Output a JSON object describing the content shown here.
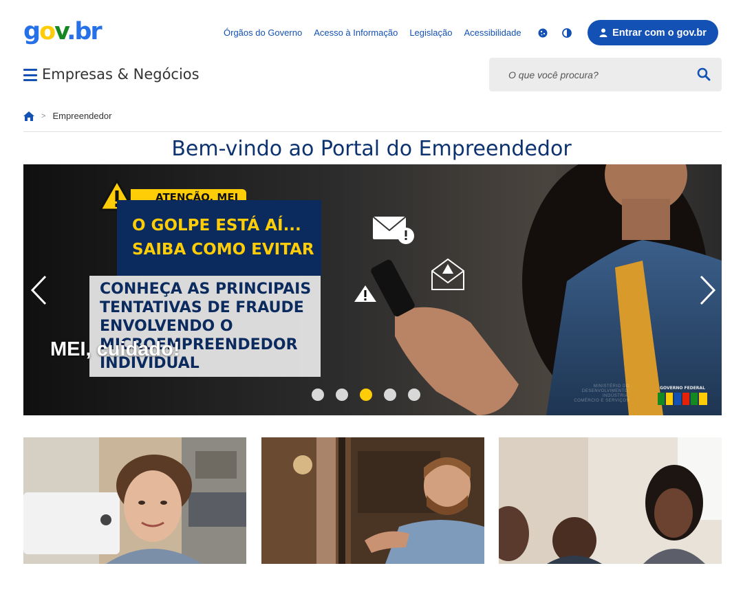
{
  "header": {
    "logo": {
      "g": "g",
      "o": "o",
      "v": "v",
      "dot": ".",
      "br": "br"
    },
    "nav_links": [
      "Órgãos do Governo",
      "Acesso à Informação",
      "Legislação",
      "Acessibilidade"
    ],
    "login_label": "Entrar com o gov.br",
    "site_title": "Empresas & Negócios",
    "search_placeholder": "O que você procura?"
  },
  "breadcrumb": {
    "current": "Empreendedor",
    "separator": ">"
  },
  "page_title": "Bem-vindo ao Portal do Empreendedor",
  "carousel": {
    "tag": "ATENÇÃO, MEI",
    "headline": [
      "O GOLPE ESTÁ AÍ...",
      "SAIBA COMO EVITAR"
    ],
    "info": [
      "CONHEÇA AS PRINCIPAIS",
      "TENTATIVAS DE FRAUDE",
      "ENVOLVENDO O",
      "MICROEMPREENDEDOR",
      "INDIVIDUAL"
    ],
    "caption": "MEI, cuidado!",
    "dot_count": 5,
    "active_dot": 2,
    "ministry_text": [
      "MINISTÉRIO DO",
      "DESENVOLVIMENTO, INDÚSTRIA,",
      "COMÉRCIO E SERVIÇOS"
    ],
    "flag_text": "GOVERNO FEDERAL"
  },
  "cards": [
    {
      "image": "woman-at-sewing-machine"
    },
    {
      "image": "man-in-workshop"
    },
    {
      "image": "people-at-meeting"
    }
  ],
  "colors": {
    "primary": "#1351b4",
    "title": "#0c326f",
    "accent_yellow": "#ffcd07",
    "gov_green": "#168821"
  },
  "icons": {
    "menu": "hamburger-menu-icon",
    "search": "magnifier-icon",
    "home": "home-icon",
    "cookie": "cookie-icon",
    "contrast": "contrast-icon",
    "user": "user-icon"
  }
}
